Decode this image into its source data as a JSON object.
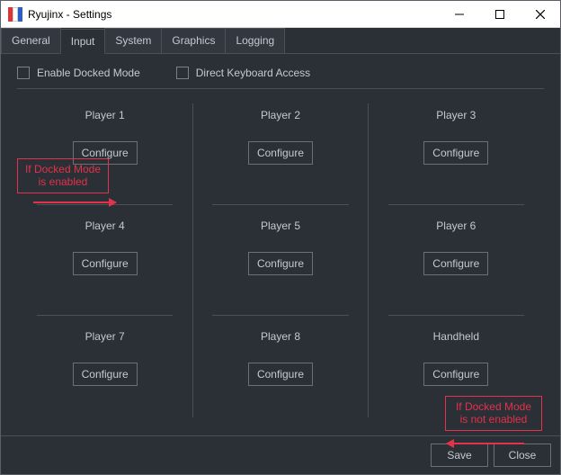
{
  "window": {
    "title": "Ryujinx - Settings"
  },
  "tabs": {
    "general": "General",
    "input": "Input",
    "system": "System",
    "graphics": "Graphics",
    "logging": "Logging",
    "active": "input"
  },
  "checks": {
    "docked": "Enable Docked Mode",
    "directkb": "Direct Keyboard Access"
  },
  "configure_label": "Configure",
  "players": [
    "Player 1",
    "Player 2",
    "Player 3",
    "Player 4",
    "Player 5",
    "Player 6",
    "Player 7",
    "Player 8",
    "Handheld"
  ],
  "annotations": {
    "docked_on": "If Docked Mode\nis enabled",
    "docked_off": "If Docked Mode\nis not enabled"
  },
  "footer": {
    "save": "Save",
    "close": "Close"
  }
}
